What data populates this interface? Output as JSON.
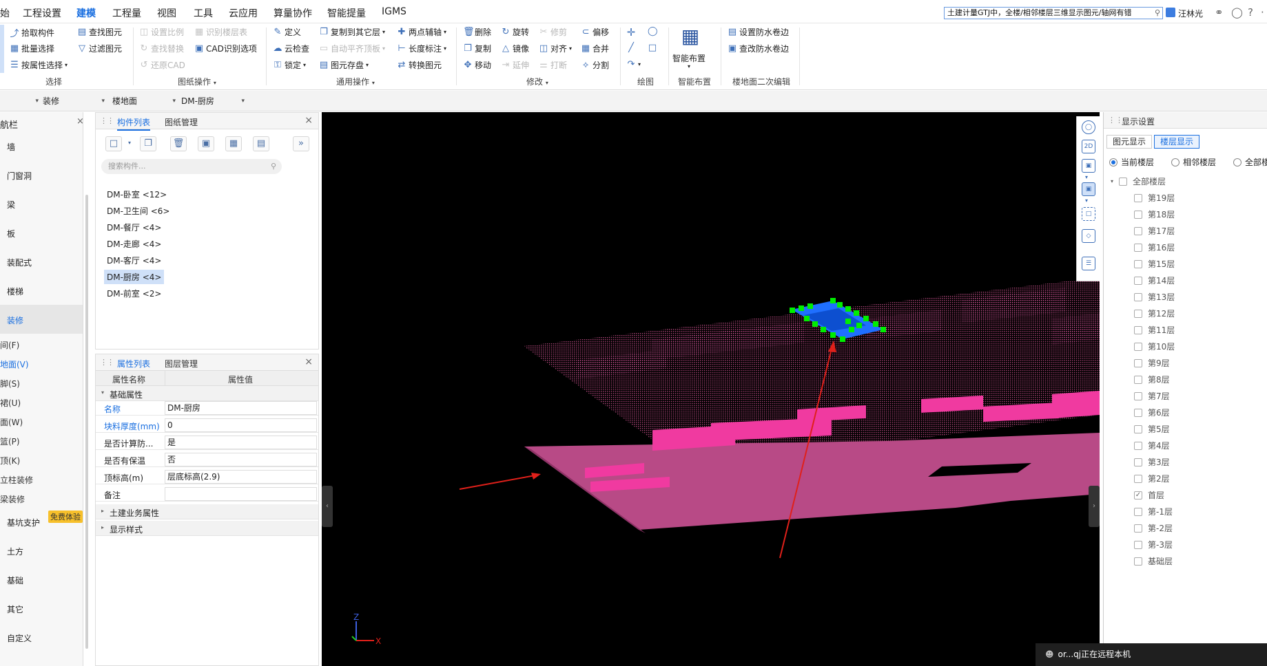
{
  "menu": {
    "items": [
      "始",
      "工程设置",
      "建模",
      "工程量",
      "视图",
      "工具",
      "云应用",
      "算量协作",
      "智能提量",
      "IGMS"
    ],
    "active": "建模"
  },
  "topbar": {
    "notice": "土建计量GTJ中，全楼/相邻楼层三维显示图元/轴网有错",
    "user": "汪林光"
  },
  "ribbon": {
    "select": {
      "label": "选择",
      "pick": "拾取构件",
      "batch": "批量选择",
      "by_attr": "按属性选择",
      "find": "查找图元",
      "filter": "过滤图元"
    },
    "drawing_ops": {
      "label": "图纸操作",
      "set_scale": "设置比例",
      "identify_floor": "识别楼层表",
      "find_replace": "查找替换",
      "cad_options": "CAD识别选项",
      "restore_cad": "还原CAD"
    },
    "common_ops": {
      "label": "通用操作",
      "define": "定义",
      "copy_to_floor": "复制到其它层",
      "two_point_axis": "两点辅轴",
      "cloud_check": "云检查",
      "auto_flat_top": "自动平齐顶板",
      "length_mark": "长度标注",
      "lock": "锁定",
      "save_element": "图元存盘",
      "convert_element": "转换图元"
    },
    "modify": {
      "label": "修改",
      "delete": "删除",
      "rotate": "旋转",
      "trim": "修剪",
      "offset": "偏移",
      "copy": "复制",
      "mirror": "镜像",
      "align": "对齐",
      "merge": "合并",
      "move": "移动",
      "extend": "延伸",
      "break": "打断",
      "split": "分割"
    },
    "draw": {
      "label": "绘图"
    },
    "smart_layout": {
      "label": "智能布置",
      "button": "智能布置"
    },
    "floor_edit": {
      "label": "楼地面二次编辑",
      "set_waterproof": "设置防水卷边",
      "check_waterproof": "查改防水卷边"
    }
  },
  "context": {
    "sel1": "装修",
    "sel2": "楼地面",
    "sel3": "DM-厨房"
  },
  "leftnav": {
    "title": "航栏",
    "items": [
      "墙",
      "门窗洞",
      "梁",
      "板",
      "装配式",
      "楼梯",
      "装修"
    ],
    "subitems": [
      "间(F)",
      "地面(V)",
      "脚(S)",
      "裙(U)",
      "面(W)",
      "篮(P)",
      "顶(K)",
      "立柱装修",
      "梁装修"
    ],
    "bottom_items": [
      "基坑支护",
      "土方",
      "基础",
      "其它",
      "自定义"
    ],
    "free_badge": "免费体验"
  },
  "component_panel": {
    "tabs": [
      "构件列表",
      "图纸管理"
    ],
    "search_placeholder": "搜索构件...",
    "items": [
      "DM-卧室 <12>",
      "DM-卫生间 <6>",
      "DM-餐厅 <4>",
      "DM-走廊 <4>",
      "DM-客厅 <4>",
      "DM-厨房 <4>",
      "DM-前室 <2>"
    ],
    "selected_index": 5
  },
  "property_panel": {
    "tabs": [
      "属性列表",
      "图层管理"
    ],
    "col_name": "属性名称",
    "col_value": "属性值",
    "group_basic": "基础属性",
    "rows": [
      {
        "k": "名称",
        "v": "DM-厨房",
        "blue": true
      },
      {
        "k": "块料厚度(mm)",
        "v": "0",
        "blue": true
      },
      {
        "k": "是否计算防...",
        "v": "是",
        "blue": false
      },
      {
        "k": "是否有保温",
        "v": "否",
        "blue": false
      },
      {
        "k": "顶标高(m)",
        "v": "层底标高(2.9)",
        "blue": false
      },
      {
        "k": "备注",
        "v": "",
        "blue": false
      }
    ],
    "group_civil": "土建业务属性",
    "group_display": "显示样式"
  },
  "display_panel": {
    "title": "显示设置",
    "tabs": [
      "图元显示",
      "楼层显示"
    ],
    "radios": [
      "当前楼层",
      "相邻楼层",
      "全部楼"
    ],
    "all_floors": "全部楼层",
    "floors": [
      "第19层",
      "第18层",
      "第17层",
      "第16层",
      "第15层",
      "第14层",
      "第13层",
      "第12层",
      "第11层",
      "第10层",
      "第9层",
      "第8层",
      "第7层",
      "第6层",
      "第5层",
      "第4层",
      "第3层",
      "第2层",
      "首层",
      "第-1层",
      "第-2层",
      "第-3层",
      "基础层"
    ],
    "checked_floor": "首层"
  },
  "viewport": {
    "axis_z": "Z",
    "axis_x": "X"
  },
  "status": {
    "remote": "or...qj正在远程本机"
  },
  "colors": {
    "accent": "#1a6fe0",
    "slab_magenta": "#e8359a",
    "selected_blue": "#1f6fff",
    "grip_green": "#00ee00",
    "arrow_red": "#e0201a"
  }
}
